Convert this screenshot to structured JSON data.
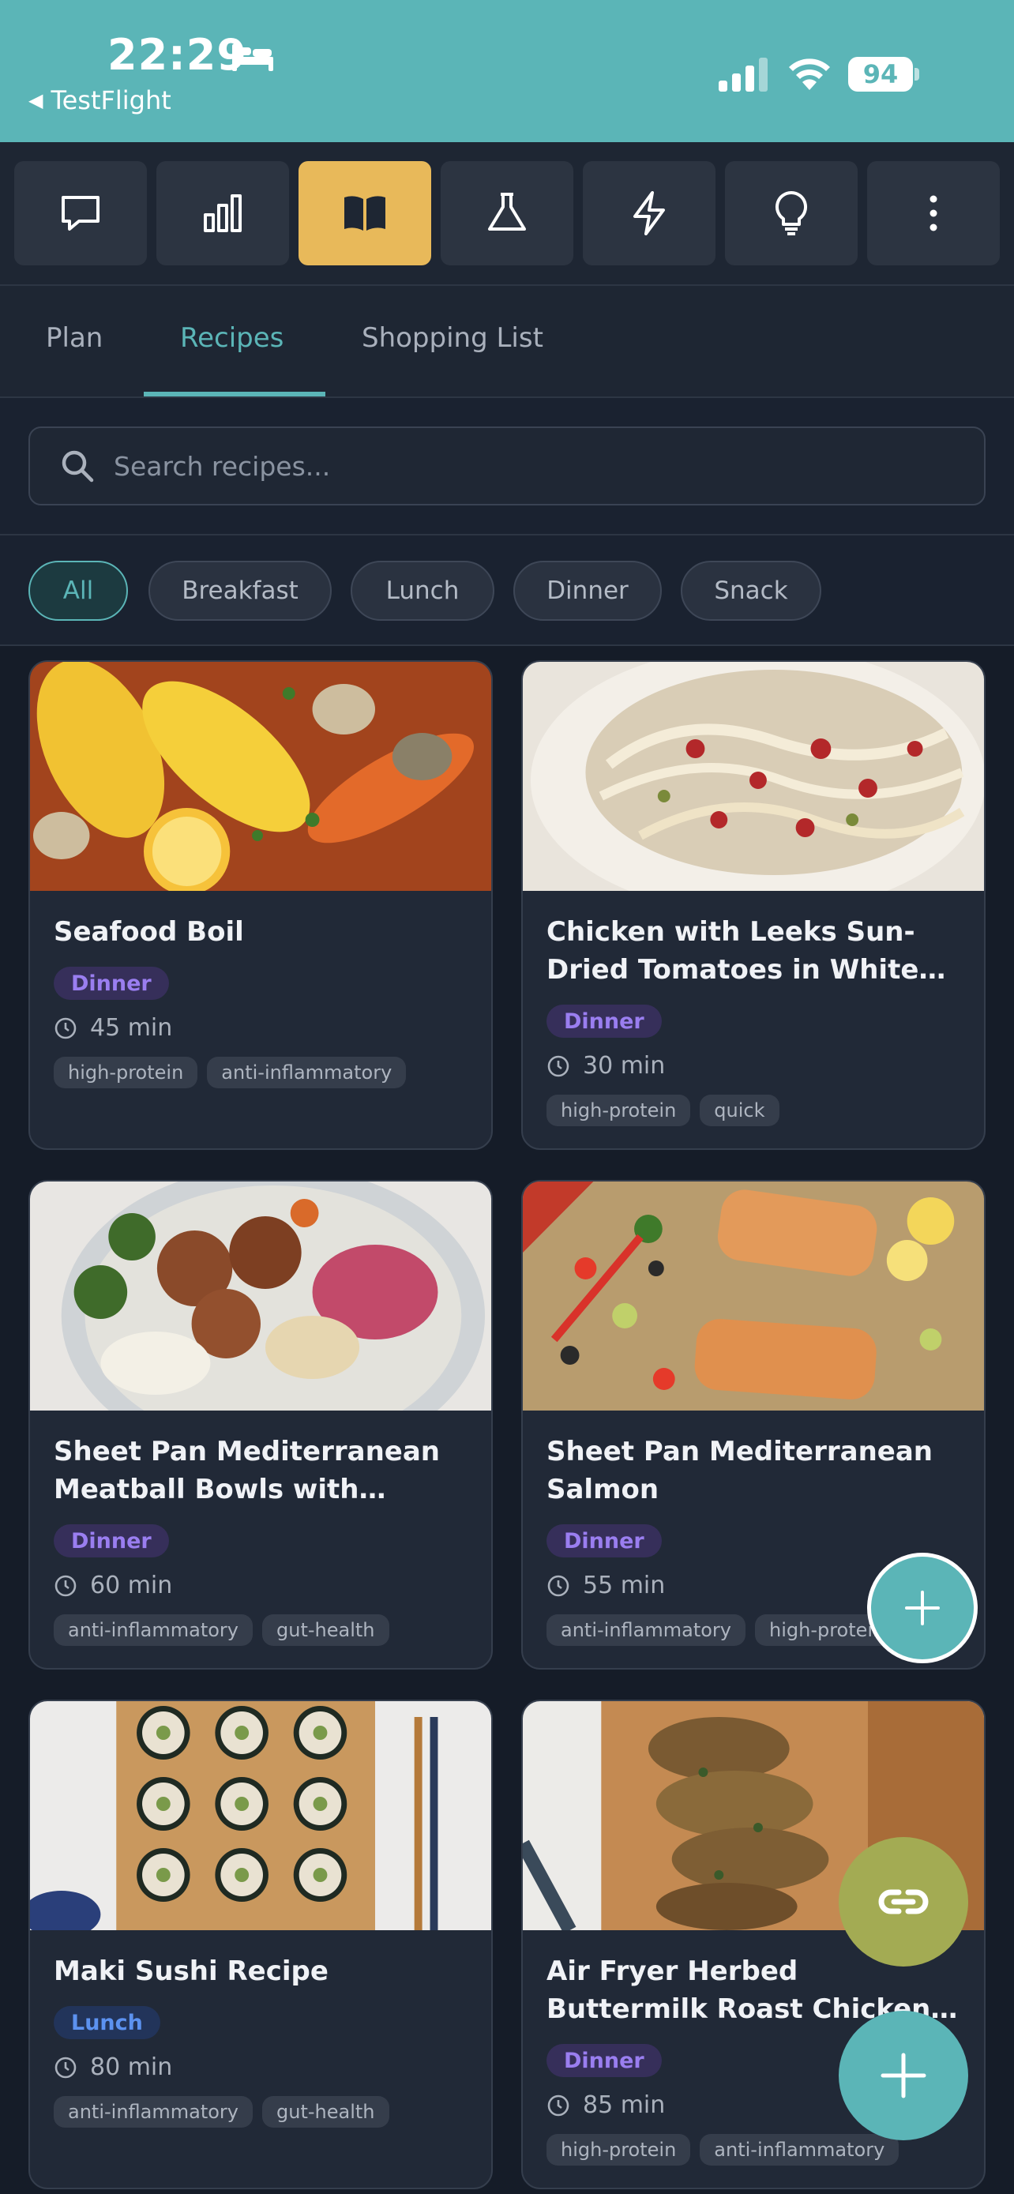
{
  "status_bar": {
    "time": "22:29",
    "back_label": "TestFlight",
    "battery": "94"
  },
  "toolbar": {
    "buttons": [
      {
        "icon": "chat-bubble-icon",
        "active": false
      },
      {
        "icon": "bar-chart-icon",
        "active": false
      },
      {
        "icon": "book-icon",
        "active": true
      },
      {
        "icon": "flask-icon",
        "active": false
      },
      {
        "icon": "lightning-icon",
        "active": false
      },
      {
        "icon": "lightbulb-icon",
        "active": false
      },
      {
        "icon": "more-vertical-icon",
        "active": false
      }
    ],
    "active_color": "#e8b95a"
  },
  "tabs": [
    {
      "label": "Plan",
      "active": false
    },
    {
      "label": "Recipes",
      "active": true
    },
    {
      "label": "Shopping List",
      "active": false
    }
  ],
  "search": {
    "placeholder": "Search recipes...",
    "value": ""
  },
  "filters": [
    {
      "label": "All",
      "active": true
    },
    {
      "label": "Breakfast",
      "active": false
    },
    {
      "label": "Lunch",
      "active": false
    },
    {
      "label": "Dinner",
      "active": false
    },
    {
      "label": "Snack",
      "active": false
    }
  ],
  "recipes": [
    {
      "title": "Seafood Boil",
      "meal": "Dinner",
      "time": "45 min",
      "tags": [
        "high-protein",
        "anti-inflammatory"
      ]
    },
    {
      "title": "Chicken with Leeks Sun-Dried Tomatoes in White Wine Sauce",
      "meal": "Dinner",
      "time": "30 min",
      "tags": [
        "high-protein",
        "quick"
      ]
    },
    {
      "title": "Sheet Pan Mediterranean Meatball Bowls with Roasted Vegetables",
      "meal": "Dinner",
      "time": "60 min",
      "tags": [
        "anti-inflammatory",
        "gut-health"
      ]
    },
    {
      "title": "Sheet Pan Mediterranean Salmon",
      "meal": "Dinner",
      "time": "55 min",
      "tags": [
        "anti-inflammatory",
        "high-protein"
      ]
    },
    {
      "title": "Maki Sushi Recipe",
      "meal": "Lunch",
      "time": "80 min",
      "tags": [
        "anti-inflammatory",
        "gut-health"
      ]
    },
    {
      "title": "Air Fryer Herbed Buttermilk Roast Chicken Breast",
      "meal": "Dinner",
      "time": "85 min",
      "tags": [
        "high-protein",
        "anti-inflammatory"
      ]
    }
  ],
  "colors": {
    "accent": "#5bb5b7",
    "dinner_badge": "#9a7ef0",
    "lunch_badge": "#5c92f0",
    "link_fab": "#a3ab53"
  }
}
